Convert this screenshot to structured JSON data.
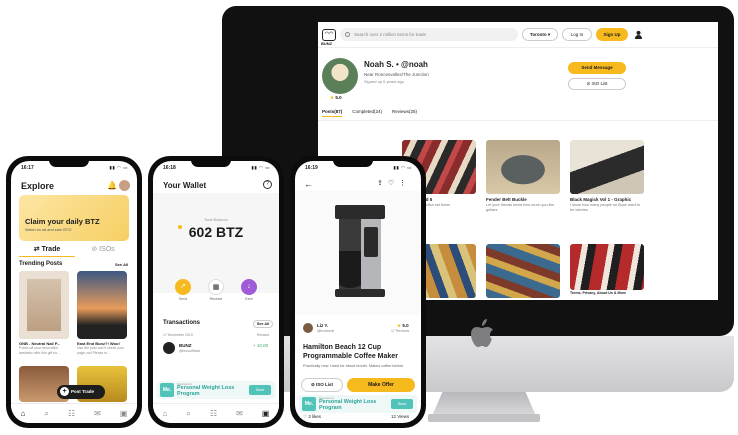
{
  "web": {
    "logo": "BUNZ",
    "search_placeholder": "Search over 2 million items for trade",
    "city": "Toronto",
    "login": "Log In",
    "signup": "Sign Up",
    "profile": {
      "name": "Noah S. • @noah",
      "location": "Near Roncesvalles/The Junction",
      "since": "Signed up 6 years ago",
      "rating": "5.0"
    },
    "send_message": "Send Message",
    "iso_list": "ISO List",
    "tabs": [
      "Posts(87)",
      "Completed(24)",
      "Reviews(25)"
    ],
    "cards": [
      {
        "title": "Vol 1, 2, And 5",
        "desc": "the entire selection set these"
      },
      {
        "title": "Fender Belt Buckle",
        "desc": "Let your friends know how much you like guitars"
      },
      {
        "title": "Black Magick Vol 1 - Graphic",
        "desc": "I know how many people on Bunz want to be witches"
      },
      {
        "title": "",
        "desc": ""
      },
      {
        "title": "",
        "desc": ""
      },
      {
        "title": "Terms, Privacy, About Us & More",
        "desc": ""
      }
    ]
  },
  "phone_explore": {
    "time": "16:17",
    "title": "Explore",
    "banner_title": "Claim your daily BTZ",
    "banner_sub": "Watch an ad and earn BTZ!",
    "tab_trade": "Trade",
    "tab_isos": "ISOs",
    "trending": "Trending Posts",
    "see_all": "See All",
    "cards": [
      {
        "title": "GNB - Neutral Nail P...",
        "desc": "Polish off your renovated aesthetic with this gift bo..."
      },
      {
        "title": "East End Bunz?! Woo!",
        "desc": "Use the post and it check your page out! Please m..."
      }
    ],
    "post_trade": "Post Trade"
  },
  "phone_wallet": {
    "time": "16:18",
    "title": "Your Wallet",
    "balance_label": "Total Balance",
    "balance": "602 BTZ",
    "actions": [
      "Send",
      "Receive",
      "Earn"
    ],
    "transactions_title": "Transactions",
    "see_all": "See All",
    "date": "17 November 2019",
    "reward_label": "Reward",
    "tx": {
      "name": "BUNZ",
      "sub": "@bunzofficial",
      "amount": "+ 10.00"
    }
  },
  "phone_product": {
    "time": "16:19",
    "user": "Liz Y.",
    "user_sub": "@lizdrewst",
    "rating": "5.0",
    "reviews": "17 Reviews",
    "title": "Hamilton Beach 12 Cup Programmable Coffee Maker",
    "desc": "Practically new. Used for about month. Makes coffee before",
    "iso_list": "ISO List",
    "make_offer": "Make Offer",
    "likes": "3 likes",
    "views": "12 Views"
  },
  "ad": {
    "logo": "Me.",
    "sponsor": "Sponsored",
    "text": "Personal Weight Loss Program",
    "button": "Save"
  },
  "colors": {
    "accent": "#f6b91e",
    "ad": "#52c3b9"
  }
}
